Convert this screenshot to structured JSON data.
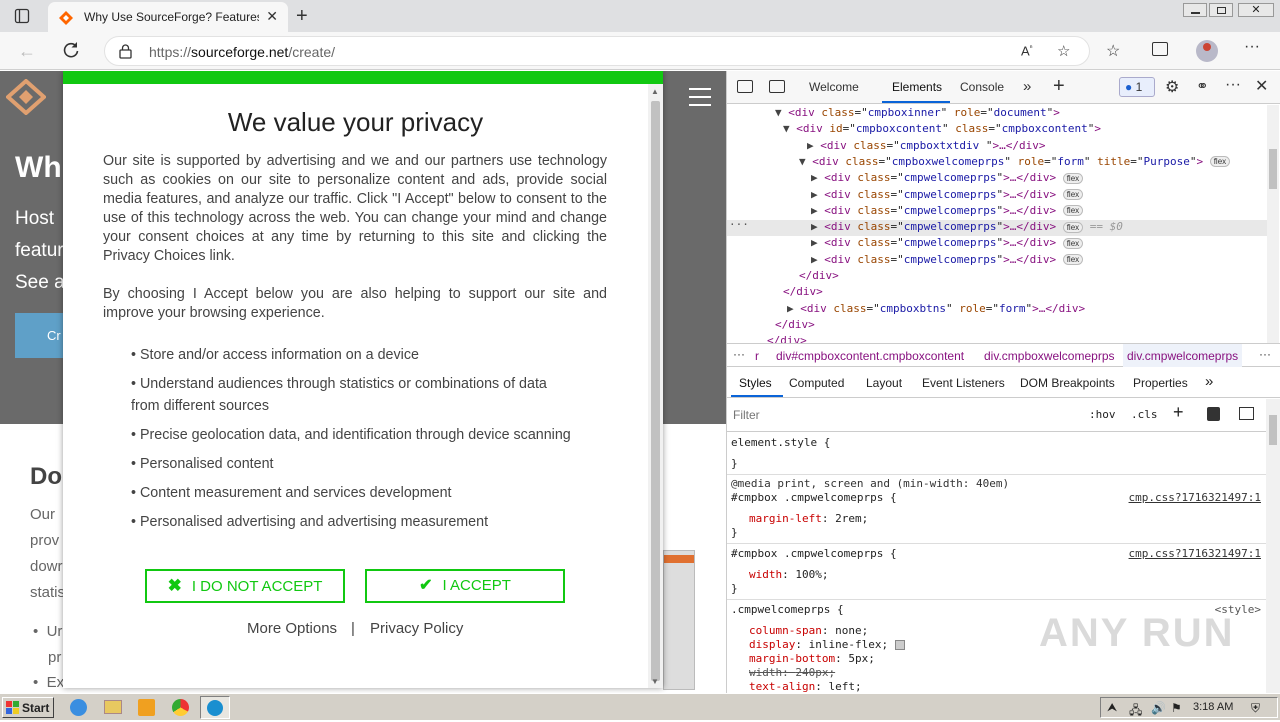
{
  "browser": {
    "tab_title": "Why Use SourceForge? Features a",
    "url_scheme": "https://",
    "url_host": "sourceforge.net",
    "url_path": "/create/"
  },
  "page_behind": {
    "heading_fragment": "Wh",
    "text_fragments": [
      "Host",
      "featur",
      "See a"
    ],
    "button_fragment": "Cr",
    "subheading_fragment": "Do",
    "para_fragments": [
      "Our",
      "prov",
      "dowr",
      "statis"
    ],
    "bullet_fragments": [
      "Ur",
      "pr",
      "Ex"
    ]
  },
  "modal": {
    "title": "We value your privacy",
    "paragraph1": "Our site is supported by advertising and we and our partners use technology such as cookies on our site to personalize content and ads, provide social media features, and analyze our traffic. Click \"I Accept\" below to consent to the use of this technology across the web. You can change your mind and change your consent choices at any time by returning to this site and clicking the Privacy Choices link.",
    "paragraph2": "By choosing I Accept below you are also helping to support our site and improve your browsing experience.",
    "purposes": [
      "• Store and/or access information on a device",
      "• Understand audiences through statistics or combinations of data from different sources",
      "• Precise geolocation data, and identification through device scanning",
      "• Personalised content",
      "• Content measurement and services development",
      "• Personalised advertising and advertising measurement"
    ],
    "reject_label": "I DO NOT ACCEPT",
    "accept_label": "I ACCEPT",
    "more_options": "More Options",
    "divider": "|",
    "privacy_policy": "Privacy Policy"
  },
  "devtools": {
    "tabs": [
      "Welcome",
      "Elements",
      "Console"
    ],
    "issues_count": "1",
    "dom_lines": [
      {
        "pre": "▼ ",
        "tag": "div",
        "attrs": [
          [
            "class",
            "cmpboxinner"
          ],
          [
            "role",
            "document"
          ]
        ],
        "tail": ">",
        "badge": ""
      },
      {
        "pre": "▼ ",
        "tag": "div",
        "attrs": [
          [
            "id",
            "cmpboxcontent"
          ],
          [
            "class",
            "cmpboxcontent"
          ]
        ],
        "tail": ">",
        "badge": ""
      },
      {
        "pre": "▶ ",
        "tag": "div",
        "attrs": [
          [
            "class",
            "cmpboxtxtdiv "
          ]
        ],
        "tail": ">…</div>",
        "badge": ""
      },
      {
        "pre": "▼ ",
        "tag": "div",
        "attrs": [
          [
            "class",
            "cmpboxwelcomeprps"
          ],
          [
            "role",
            "form"
          ],
          [
            "title",
            "Purpose"
          ]
        ],
        "tail": ">",
        "badge": "flex"
      },
      {
        "pre": "▶ ",
        "tag": "div",
        "attrs": [
          [
            "class",
            "cmpwelcomeprps"
          ]
        ],
        "tail": ">…</div>",
        "badge": "flex"
      },
      {
        "pre": "▶ ",
        "tag": "div",
        "attrs": [
          [
            "class",
            "cmpwelcomeprps"
          ]
        ],
        "tail": ">…</div>",
        "badge": "flex"
      },
      {
        "pre": "▶ ",
        "tag": "div",
        "attrs": [
          [
            "class",
            "cmpwelcomeprps"
          ]
        ],
        "tail": ">…</div>",
        "badge": "flex"
      },
      {
        "pre": "▶ ",
        "tag": "div",
        "attrs": [
          [
            "class",
            "cmpwelcomeprps"
          ]
        ],
        "tail": ">…</div>",
        "badge": "flex",
        "extra": " == $0"
      },
      {
        "pre": "▶ ",
        "tag": "div",
        "attrs": [
          [
            "class",
            "cmpwelcomeprps"
          ]
        ],
        "tail": ">…</div>",
        "badge": "flex"
      },
      {
        "pre": "▶ ",
        "tag": "div",
        "attrs": [
          [
            "class",
            "cmpwelcomeprps"
          ]
        ],
        "tail": ">…</div>",
        "badge": "flex"
      },
      {
        "pre": "",
        "tag": "",
        "raw": "</div>"
      },
      {
        "pre": "",
        "tag": "",
        "raw": "</div>"
      },
      {
        "pre": "▶ ",
        "tag": "div",
        "attrs": [
          [
            "class",
            "cmpboxbtns"
          ],
          [
            "role",
            "form"
          ]
        ],
        "tail": ">…</div>",
        "badge": ""
      },
      {
        "pre": "",
        "tag": "",
        "raw": "</div>"
      },
      {
        "pre": "",
        "tag": "",
        "raw": "</div>"
      }
    ],
    "breadcrumbs": [
      "r",
      "div#cmpboxcontent.cmpboxcontent",
      "div.cmpboxwelcomeprps",
      "div.cmpwelcomeprps"
    ],
    "style_tabs": [
      "Styles",
      "Computed",
      "Layout",
      "Event Listeners",
      "DOM Breakpoints",
      "Properties"
    ],
    "filter_placeholder": "Filter",
    "hov": ":hov",
    "cls": ".cls",
    "rules": {
      "element_style": "element.style {",
      "close": "}",
      "media": "@media print, screen and (min-width: 40em)",
      "r1_sel": "#cmpbox .cmpwelcomeprps {",
      "r1_src": "cmp.css?1716321497:1",
      "r1_prop": "margin-left",
      "r1_val": "2rem;",
      "r2_sel": "#cmpbox .cmpwelcomeprps {",
      "r2_src": "cmp.css?1716321497:1",
      "r2_prop": "width",
      "r2_val": "100%;",
      "r3_sel": ".cmpwelcomeprps {",
      "r3_src": "<style>",
      "r3_props": [
        [
          "column-span",
          "none;"
        ],
        [
          "display",
          "inline-flex;"
        ],
        [
          "margin-bottom",
          "5px;"
        ],
        [
          "width",
          "240px;"
        ],
        [
          "text-align",
          "left;"
        ]
      ]
    }
  },
  "taskbar": {
    "start": "Start",
    "clock": "3:18 AM"
  },
  "watermark": "ANY RUN",
  "colors": {
    "accent_green": "#11c811",
    "hero_bg": "#6a6a6a"
  }
}
